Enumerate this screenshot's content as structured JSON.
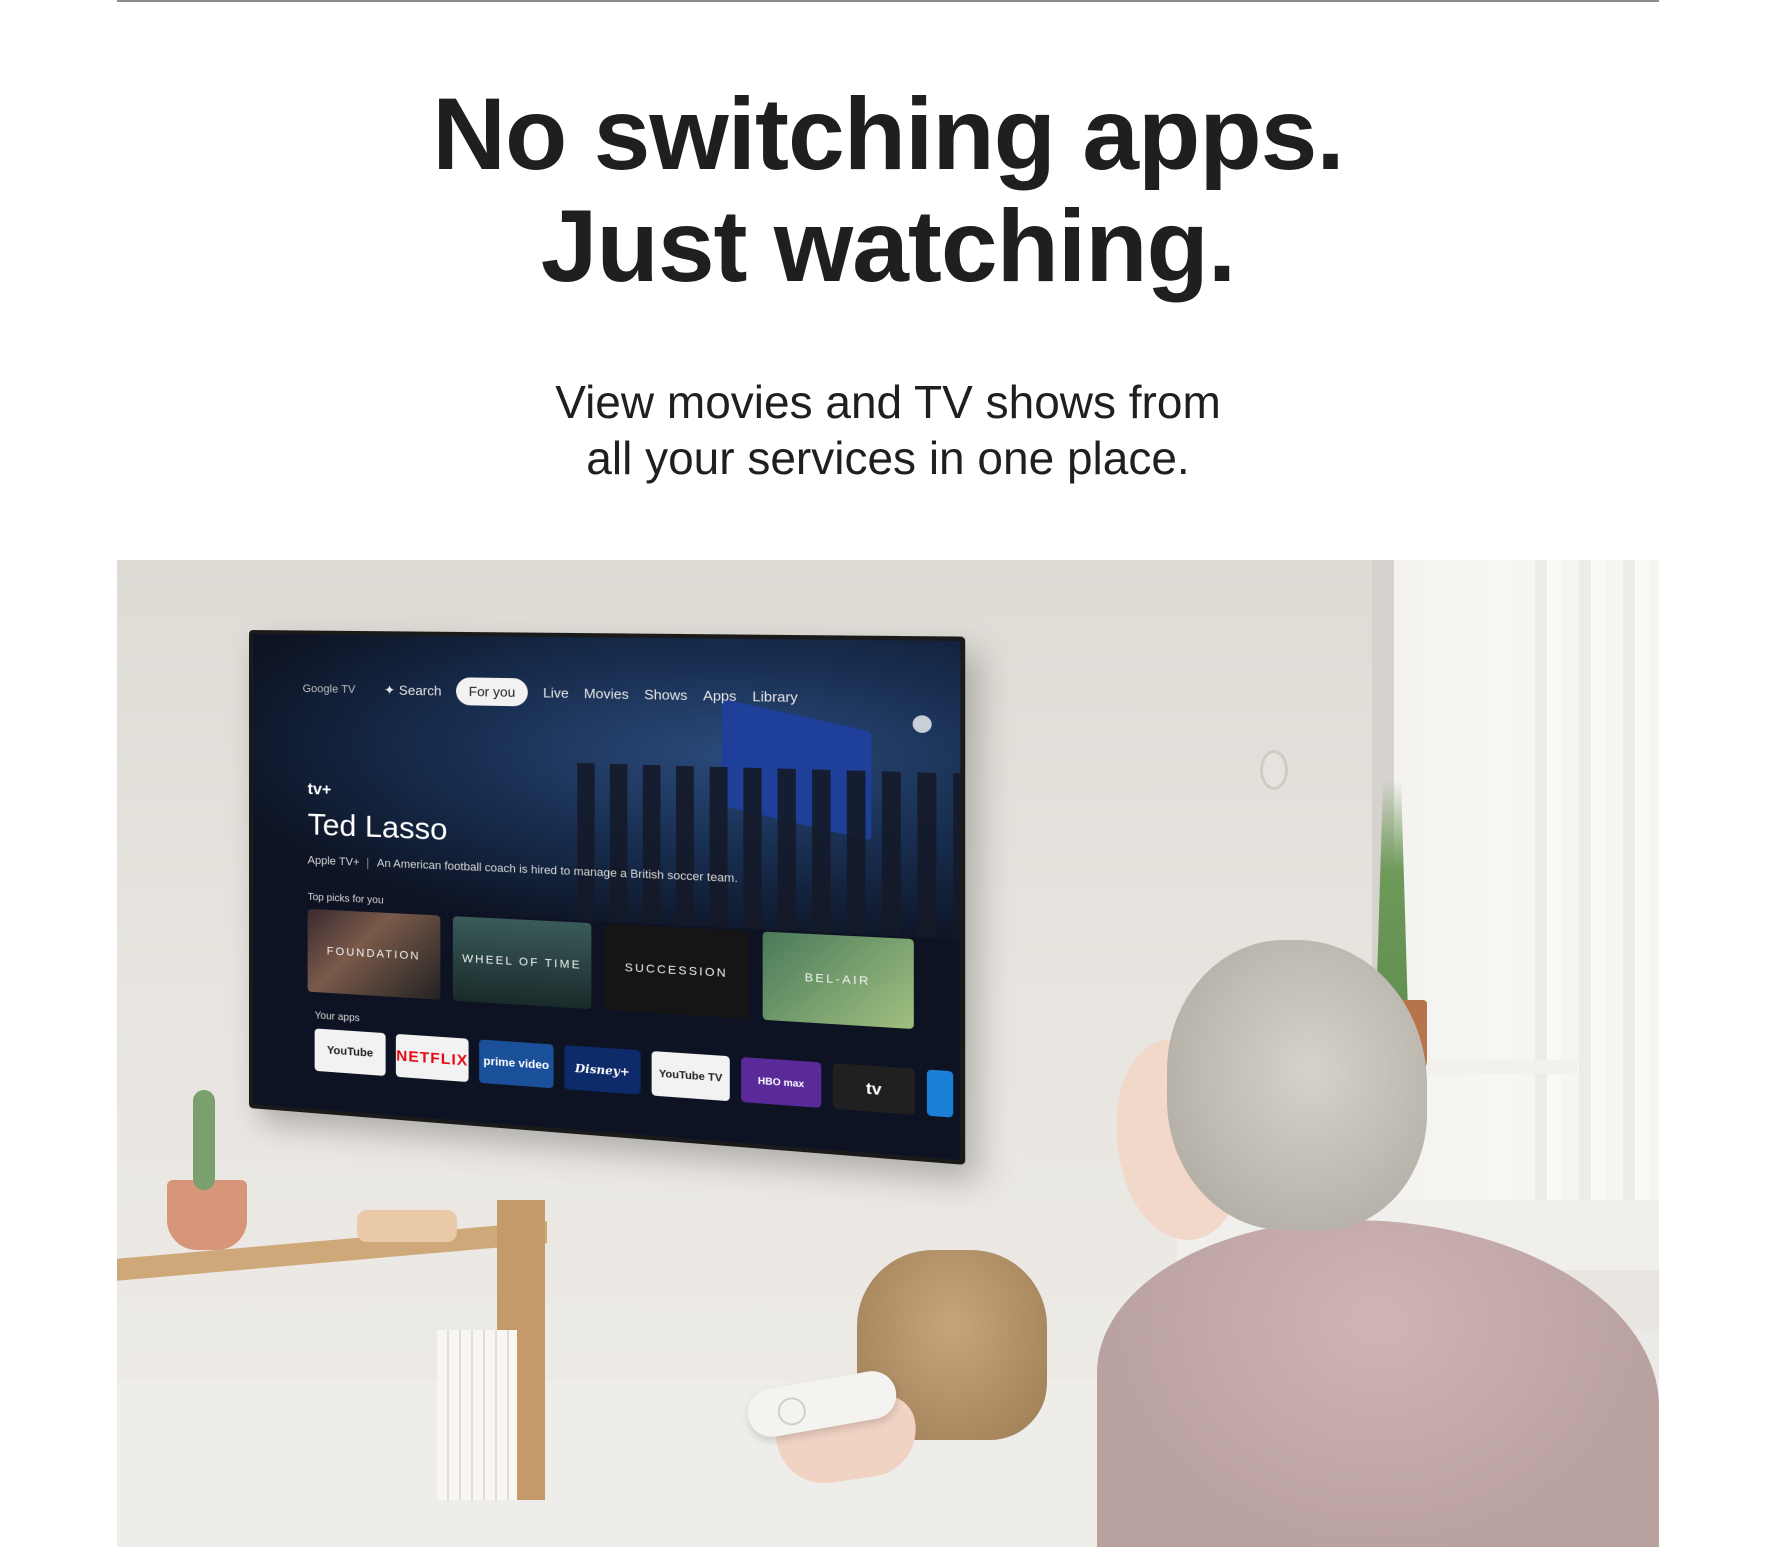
{
  "hero": {
    "headline_line1": "No switching apps.",
    "headline_line2": "Just watching.",
    "subline_line1": "View movies and TV shows from",
    "subline_line2": "all your services in one place."
  },
  "tv": {
    "brand": "Google TV",
    "nav": [
      "Search",
      "For you",
      "Live",
      "Movies",
      "Shows",
      "Apps",
      "Library"
    ],
    "selected_tab": "For you",
    "featured": {
      "provider": "tv+",
      "title": "Ted Lasso",
      "service": "Apple TV+",
      "description": "An American football coach is hired to manage a British soccer team."
    },
    "top_picks_label": "Top picks for you",
    "top_picks": [
      "FOUNDATION",
      "WHEEL OF TIME",
      "SUCCESSION",
      "BEL-AIR"
    ],
    "your_apps_label": "Your apps",
    "apps": [
      "YouTube",
      "NETFLIX",
      "prime video",
      "Disney+",
      "YouTube TV",
      "HBO max",
      "tv"
    ]
  },
  "colors": {
    "headline": "#1f1f1f",
    "tv_background": "#0d1322",
    "netflix_red": "#e50914"
  }
}
